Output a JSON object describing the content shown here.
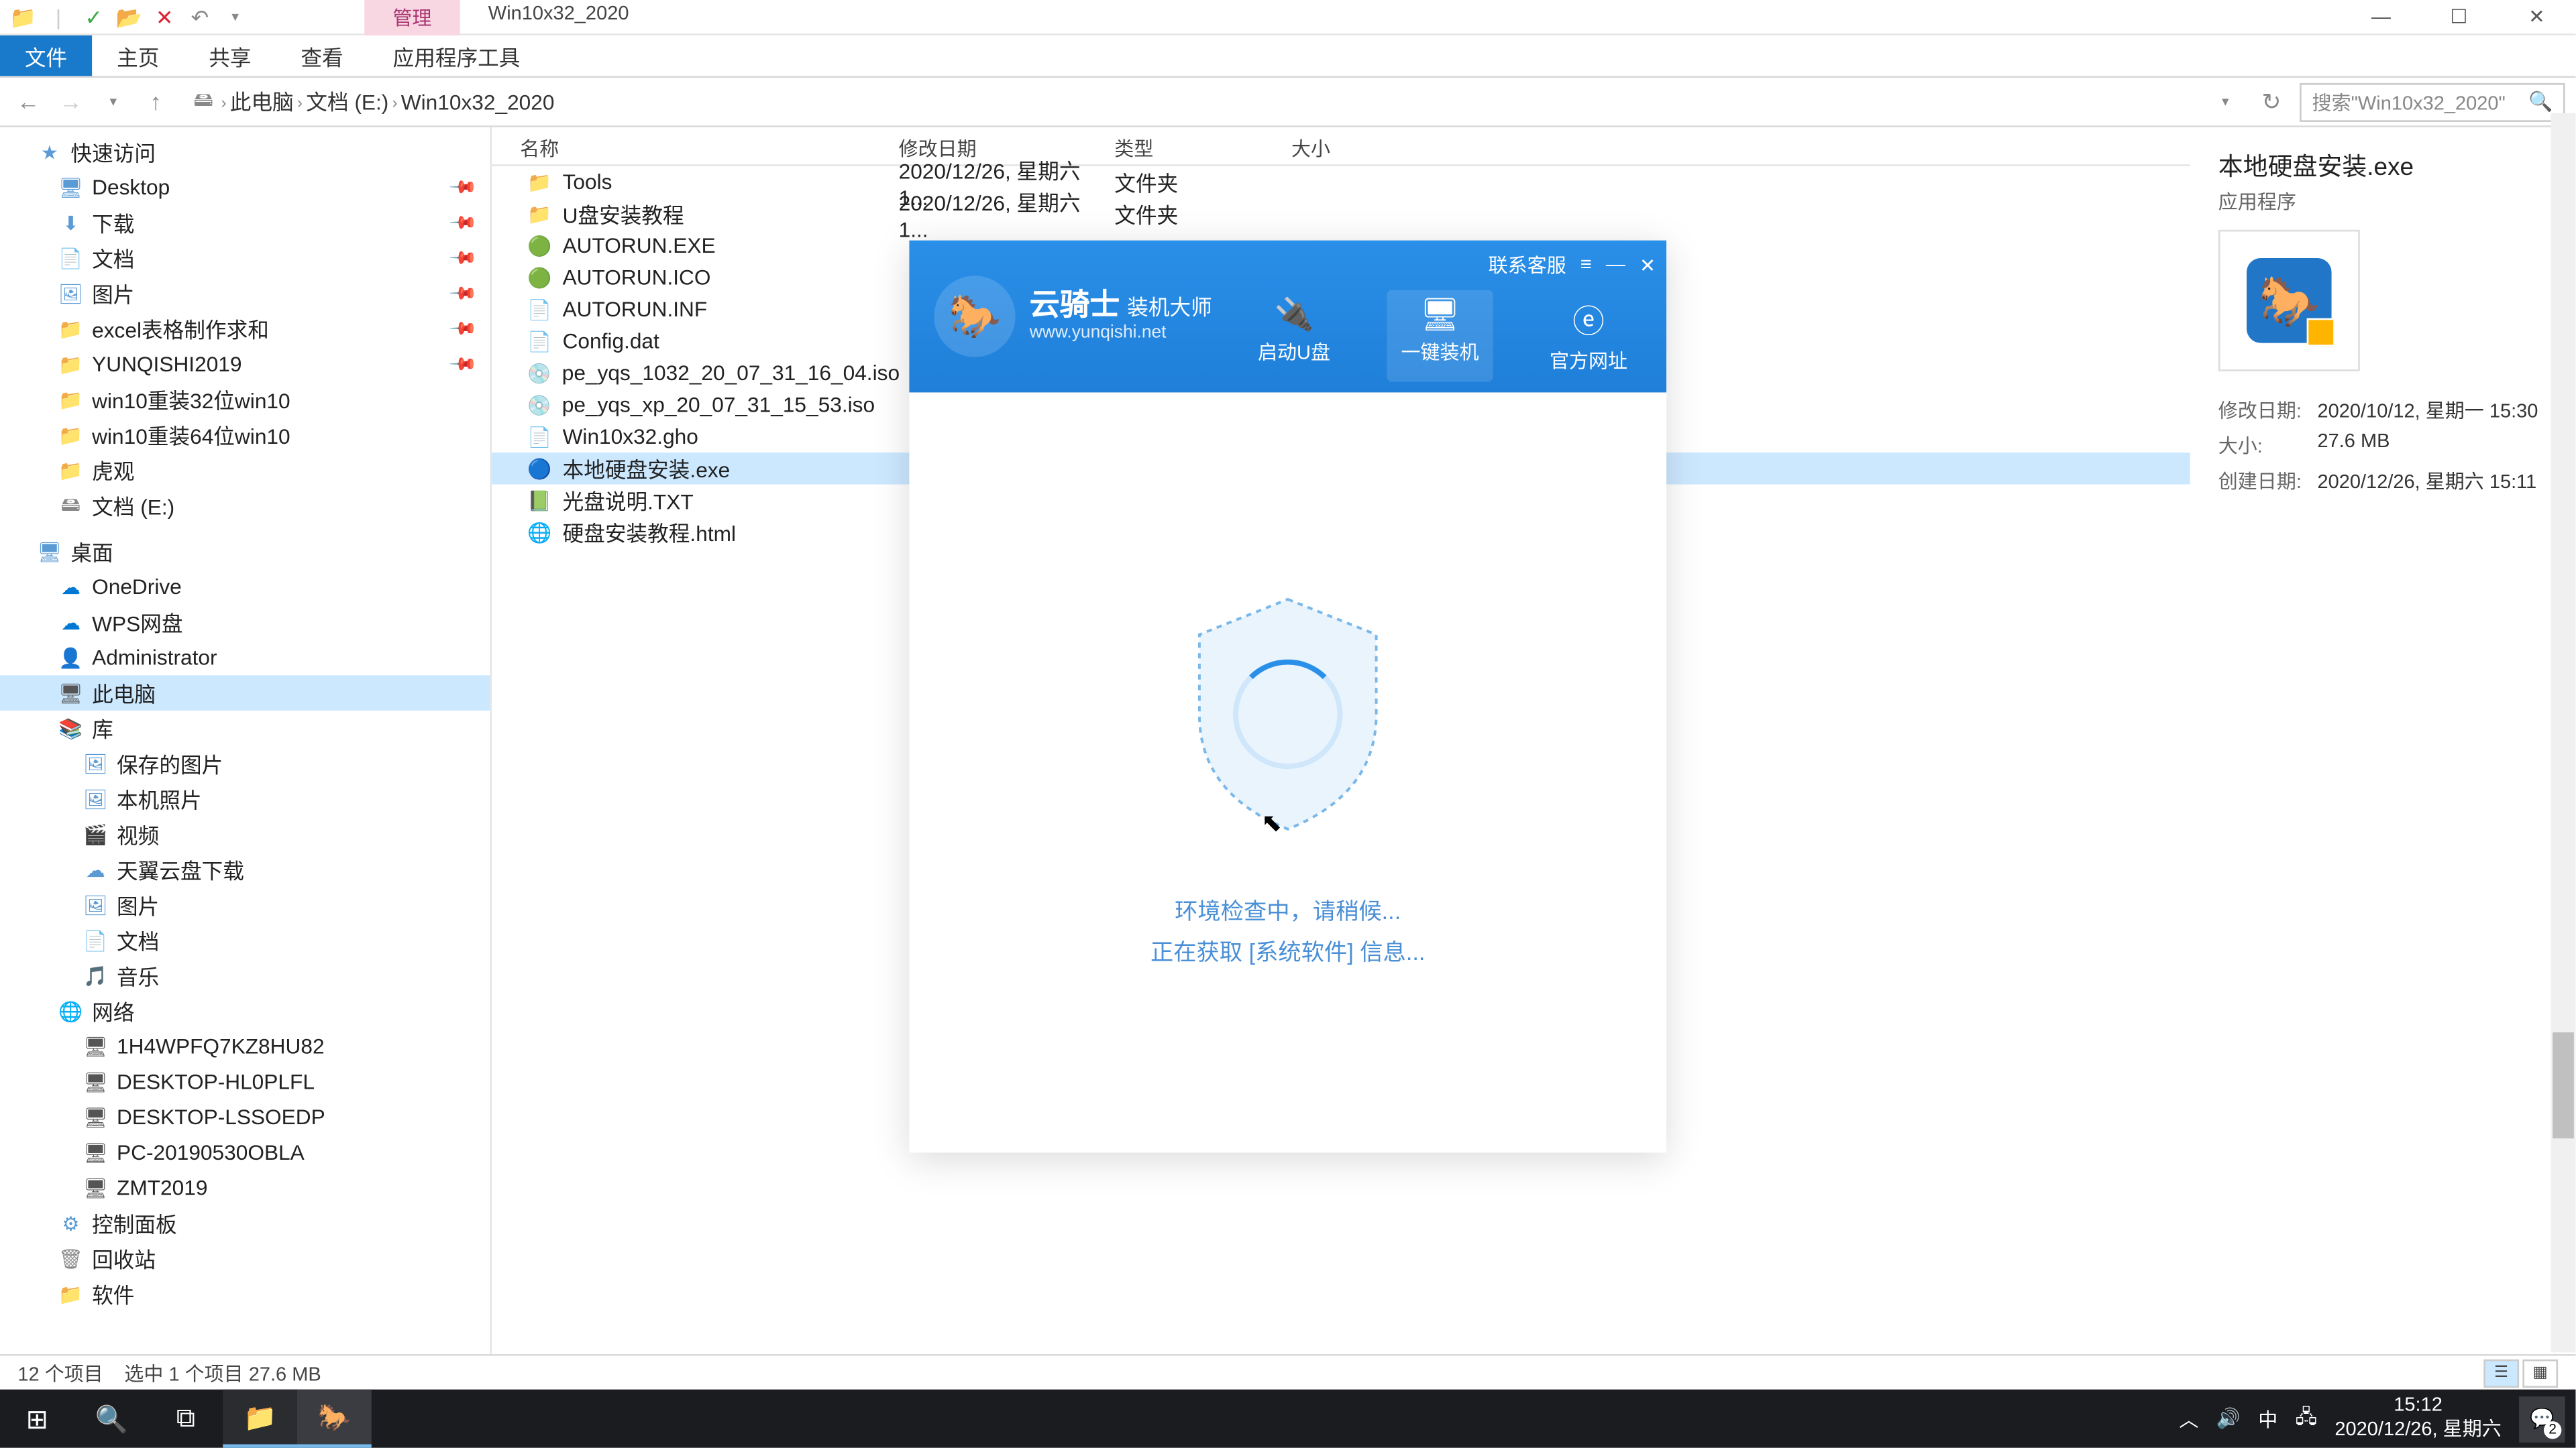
{
  "titlebar": {
    "tabs": {
      "manage": "管理",
      "title": "Win10x32_2020"
    }
  },
  "window_controls": {
    "min": "—",
    "max": "☐",
    "close": "✕"
  },
  "ribbon": {
    "file": "文件",
    "home": "主页",
    "share": "共享",
    "view": "查看",
    "tools": "应用程序工具"
  },
  "breadcrumb": {
    "pc": "此电脑",
    "drive": "文档 (E:)",
    "folder": "Win10x32_2020"
  },
  "search": {
    "placeholder": "搜索\"Win10x32_2020\""
  },
  "columns": {
    "name": "名称",
    "date": "修改日期",
    "type": "类型",
    "size": "大小"
  },
  "sidebar": {
    "quick": "快速访问",
    "desktop": "Desktop",
    "downloads": "下载",
    "docs": "文档",
    "pics": "图片",
    "excel": "excel表格制作求和",
    "yun2019": "YUNQISHI2019",
    "win32": "win10重装32位win10",
    "win64": "win10重装64位win10",
    "huguan": "虎观",
    "docdrive": "文档 (E:)",
    "desktop2": "桌面",
    "onedrive": "OneDrive",
    "wps": "WPS网盘",
    "admin": "Administrator",
    "thispc": "此电脑",
    "lib": "库",
    "savedpics": "保存的图片",
    "localpics": "本机照片",
    "video": "视频",
    "tianyi": "天翼云盘下载",
    "pics2": "图片",
    "docs2": "文档",
    "music": "音乐",
    "network": "网络",
    "net1": "1H4WPFQ7KZ8HU82",
    "net2": "DESKTOP-HL0PLFL",
    "net3": "DESKTOP-LSSOEDP",
    "net4": "PC-20190530OBLA",
    "net5": "ZMT2019",
    "cpanel": "控制面板",
    "recycle": "回收站",
    "software": "软件"
  },
  "files": [
    {
      "icon": "📁",
      "name": "Tools",
      "date": "2020/12/26, 星期六 1...",
      "type": "文件夹",
      "size": ""
    },
    {
      "icon": "📁",
      "name": "U盘安装教程",
      "date": "2020/12/26, 星期六 1...",
      "type": "文件夹",
      "size": ""
    },
    {
      "icon": "🟢",
      "name": "AUTORUN.EXE",
      "date": "",
      "type": "",
      "size": ""
    },
    {
      "icon": "🟢",
      "name": "AUTORUN.ICO",
      "date": "",
      "type": "",
      "size": ""
    },
    {
      "icon": "📄",
      "name": "AUTORUN.INF",
      "date": "",
      "type": "",
      "size": ""
    },
    {
      "icon": "📄",
      "name": "Config.dat",
      "date": "",
      "type": "",
      "size": ""
    },
    {
      "icon": "💿",
      "name": "pe_yqs_1032_20_07_31_16_04.iso",
      "date": "",
      "type": "",
      "size": ""
    },
    {
      "icon": "💿",
      "name": "pe_yqs_xp_20_07_31_15_53.iso",
      "date": "",
      "type": "",
      "size": ""
    },
    {
      "icon": "📄",
      "name": "Win10x32.gho",
      "date": "",
      "type": "",
      "size": ""
    },
    {
      "icon": "🔵",
      "name": "本地硬盘安装.exe",
      "date": "",
      "type": "",
      "size": "",
      "sel": true
    },
    {
      "icon": "📗",
      "name": "光盘说明.TXT",
      "date": "",
      "type": "",
      "size": ""
    },
    {
      "icon": "🌐",
      "name": "硬盘安装教程.html",
      "date": "",
      "type": "",
      "size": ""
    }
  ],
  "details": {
    "title": "本地硬盘安装.exe",
    "type": "应用程序",
    "modified_label": "修改日期:",
    "modified": "2020/10/12, 星期一 15:30",
    "size_label": "大小:",
    "size": "27.6 MB",
    "created_label": "创建日期:",
    "created": "2020/12/26, 星期六 15:11"
  },
  "statusbar": {
    "count": "12 个项目",
    "selected": "选中 1 个项目  27.6 MB"
  },
  "dialog": {
    "contact": "联系客服",
    "menu": "≡",
    "min": "—",
    "close": "✕",
    "brand": "云骑士",
    "brand_suffix": "装机大师",
    "url": "www.yunqishi.net",
    "tab1": "启动U盘",
    "tab2": "一键装机",
    "tab3": "官方网址",
    "status1": "环境检查中，请稍候...",
    "status2": "正在获取 [系统软件] 信息..."
  },
  "tray": {
    "ime": "中",
    "time": "15:12",
    "date": "2020/12/26, 星期六",
    "notif_count": "2"
  }
}
